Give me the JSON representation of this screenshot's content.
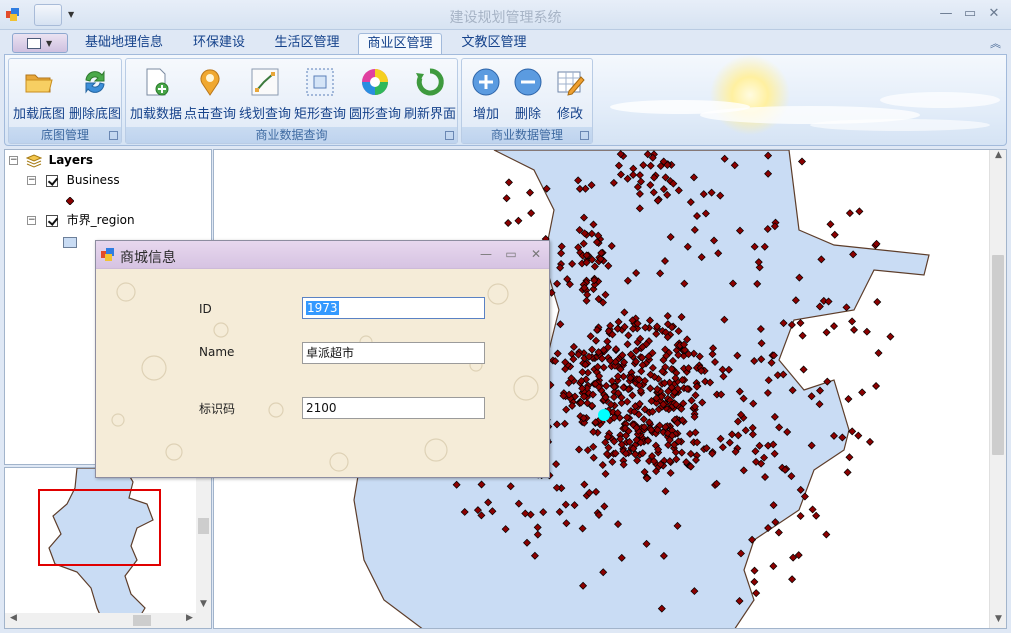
{
  "window": {
    "title": "建设规划管理系统",
    "controls": [
      "—",
      "▭",
      "✕"
    ]
  },
  "ribbon": {
    "tabs": [
      {
        "label": "基础地理信息"
      },
      {
        "label": "环保建设"
      },
      {
        "label": "生活区管理"
      },
      {
        "label": "商业区管理",
        "active": true
      },
      {
        "label": "文教区管理"
      }
    ],
    "groups": [
      {
        "label": "底图管理",
        "buttons": [
          "加载底图",
          "删除底图"
        ]
      },
      {
        "label": "商业数据查询",
        "buttons": [
          "加载数据",
          "点击查询",
          "线划查询",
          "矩形查询",
          "圆形查询",
          "刷新界面"
        ]
      },
      {
        "label": "商业数据管理",
        "buttons": [
          "增加",
          "删除",
          "修改"
        ]
      }
    ],
    "icons": {
      "加载底图": "open-folder-icon",
      "删除底图": "refresh-arrows-icon",
      "加载数据": "add-document-icon",
      "点击查询": "map-pin-icon",
      "线划查询": "polyline-icon",
      "矩形查询": "rectangle-select-icon",
      "圆形查询": "color-wheel-icon",
      "刷新界面": "refresh-icon",
      "增加": "plus-circle-icon",
      "删除": "minus-circle-icon",
      "修改": "edit-table-icon"
    }
  },
  "toc": {
    "root": "Layers",
    "layers": [
      {
        "name": "Business",
        "checked": true
      },
      {
        "name": "市界_region",
        "checked": true
      }
    ]
  },
  "dialog": {
    "title": "商城信息",
    "fields": [
      {
        "label": "ID",
        "value": "1973"
      },
      {
        "label": "Name",
        "value": "卓派超市"
      },
      {
        "label": "标识码",
        "value": "2100"
      }
    ]
  },
  "colors": {
    "region_fill": "#c9dcf4",
    "point_fill": "#8b0000",
    "highlight_point": "#00ffff",
    "overview_extent": "#e00000"
  }
}
